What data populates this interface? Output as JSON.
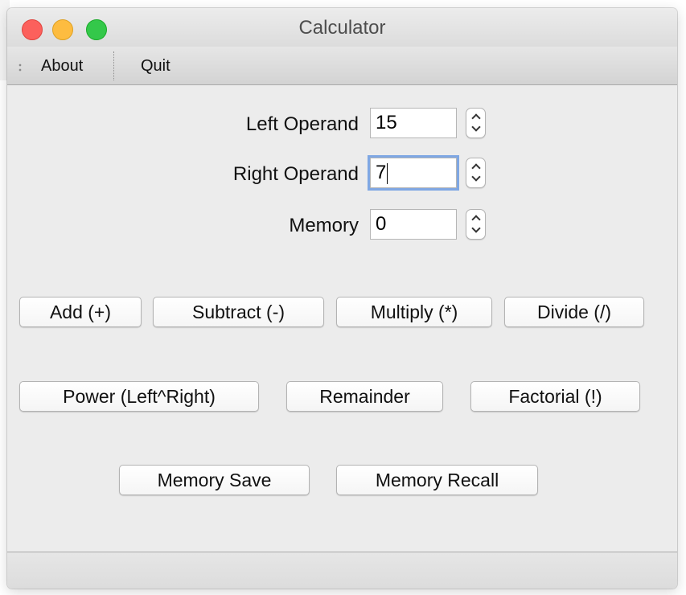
{
  "window": {
    "title": "Calculator"
  },
  "toolbar": {
    "about_label": "About",
    "quit_label": "Quit"
  },
  "fields": {
    "left_label": "Left Operand",
    "left_value": "15",
    "right_label": "Right Operand",
    "right_value": "7",
    "memory_label": "Memory",
    "memory_value": "0"
  },
  "buttons": {
    "add": "Add (+)",
    "subtract": "Subtract (-)",
    "multiply": "Multiply (*)",
    "divide": "Divide (/)",
    "power": "Power (Left^Right)",
    "remainder": "Remainder",
    "factorial": "Factorial (!)",
    "memory_save": "Memory Save",
    "memory_recall": "Memory Recall"
  },
  "icons": {
    "close": "close-light-icon",
    "minimize": "minimize-light-icon",
    "zoom": "zoom-light-icon",
    "grip": "toolbar-grip-icon",
    "stepper": "stepper-chevron-icon"
  },
  "colors": {
    "window_bg": "#ececec",
    "close": "#fc605c",
    "minimize": "#fdbc40",
    "zoom": "#34c84a",
    "focus_ring": "#7fa7e3"
  }
}
